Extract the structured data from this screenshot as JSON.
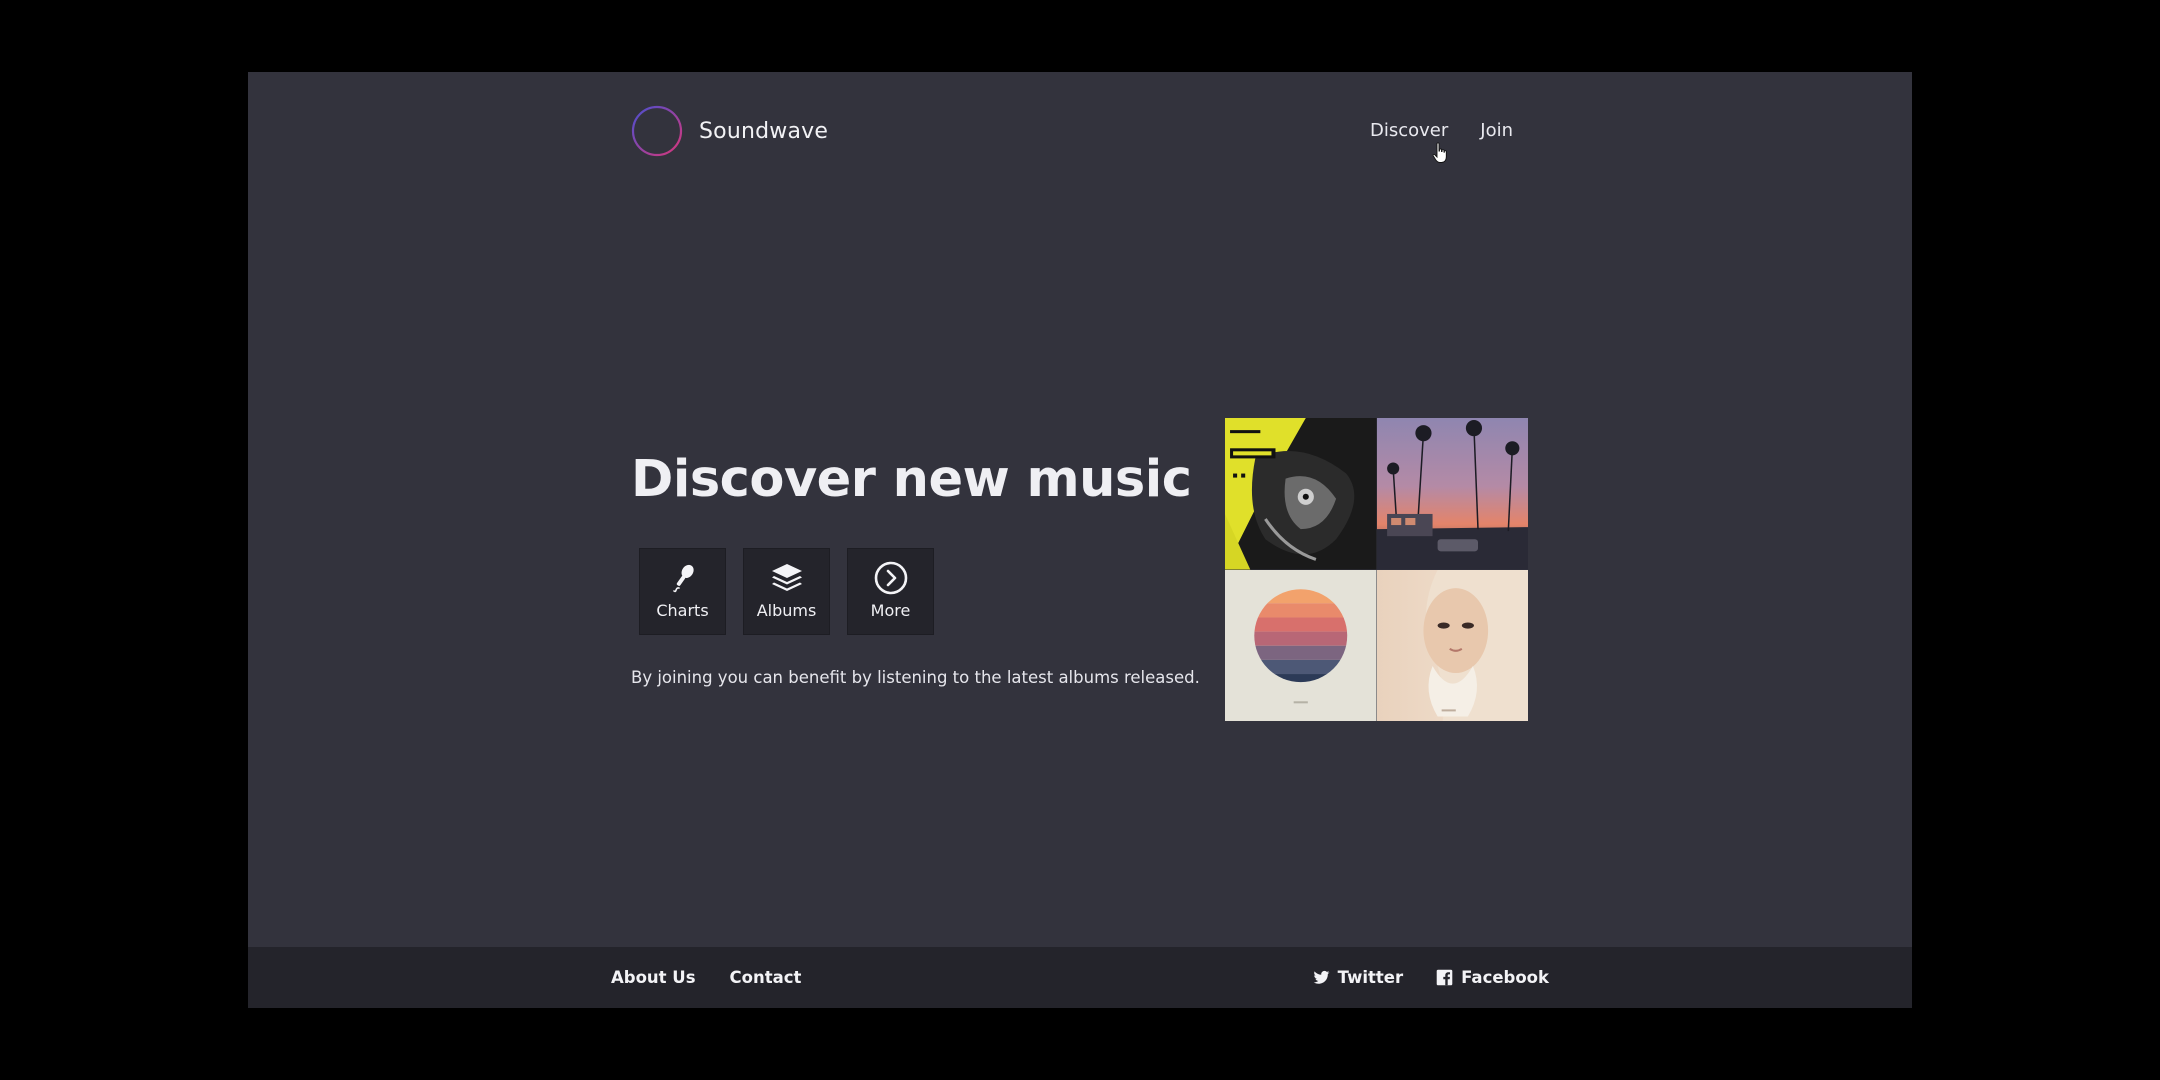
{
  "header": {
    "brand_name": "Soundwave",
    "logo_icon": "soundwave-logo-icon",
    "nav": [
      {
        "label": "Discover"
      },
      {
        "label": "Join"
      }
    ]
  },
  "hero": {
    "title": "Discover new music",
    "actions": [
      {
        "label": "Charts",
        "icon": "microphone-icon"
      },
      {
        "label": "Albums",
        "icon": "layers-icon"
      },
      {
        "label": "More",
        "icon": "chevron-circle-right-icon"
      }
    ],
    "description": "By joining you can benefit by listening to the latest albums released."
  },
  "albums": [
    {
      "name": "album-cover-yellow-bird"
    },
    {
      "name": "album-cover-palm-sunset"
    },
    {
      "name": "album-cover-striped-sun"
    },
    {
      "name": "album-cover-portrait"
    }
  ],
  "footer": {
    "left_links": [
      {
        "label": "About Us"
      },
      {
        "label": "Contact"
      }
    ],
    "social": [
      {
        "label": "Twitter",
        "icon": "twitter-icon"
      },
      {
        "label": "Facebook",
        "icon": "facebook-icon"
      }
    ]
  },
  "colors": {
    "background": "#33333d",
    "footer_background": "#24242b",
    "button_background": "#24242b",
    "logo_gradient_start": "#4b4fd0",
    "logo_gradient_end": "#d8377a"
  }
}
